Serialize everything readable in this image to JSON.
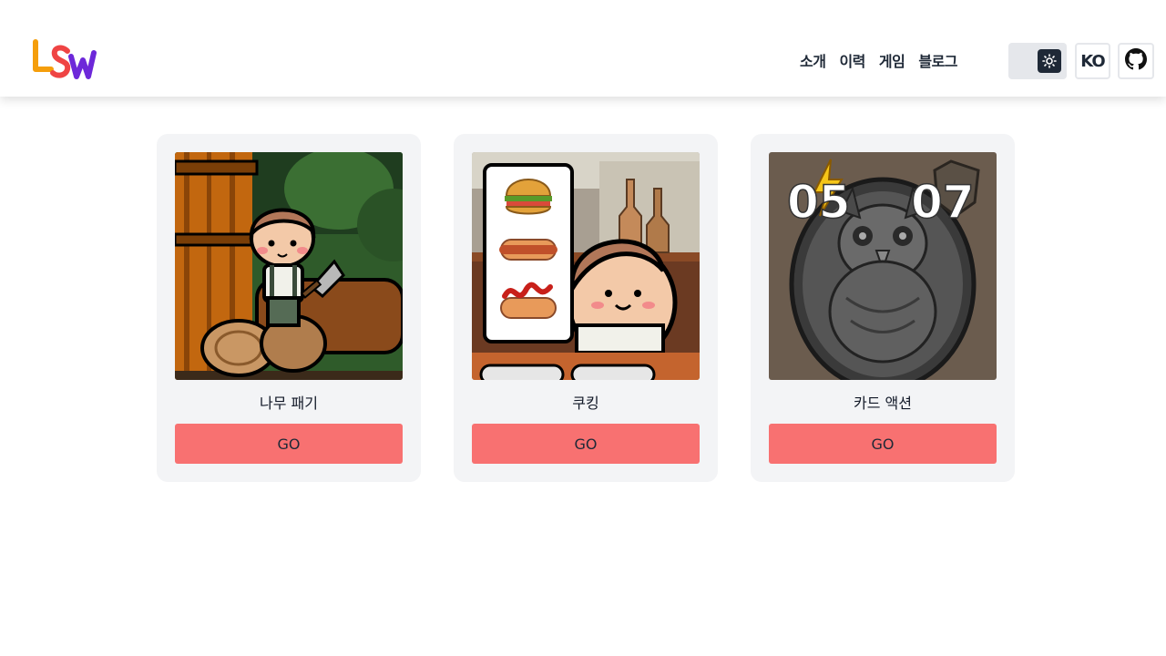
{
  "header": {
    "logo_text": "LSW",
    "nav": [
      {
        "label": "소개"
      },
      {
        "label": "이력"
      },
      {
        "label": "게임"
      },
      {
        "label": "블로그"
      }
    ],
    "language": "KO",
    "theme_icon": "sun-icon",
    "github_icon": "github-icon"
  },
  "games": [
    {
      "title": "나무 패기",
      "button": "GO",
      "image": "lumberjack-game-thumbnail"
    },
    {
      "title": "쿠킹",
      "button": "GO",
      "image": "cooking-game-thumbnail"
    },
    {
      "title": "카드 액션",
      "button": "GO",
      "image": "card-action-game-thumbnail",
      "score_left": "05",
      "score_right": "07"
    }
  ],
  "colors": {
    "go_button": "#f87171",
    "card_bg": "#f3f4f6",
    "toggle_bg": "#e5e7eb",
    "toggle_knob": "#1f2937"
  }
}
